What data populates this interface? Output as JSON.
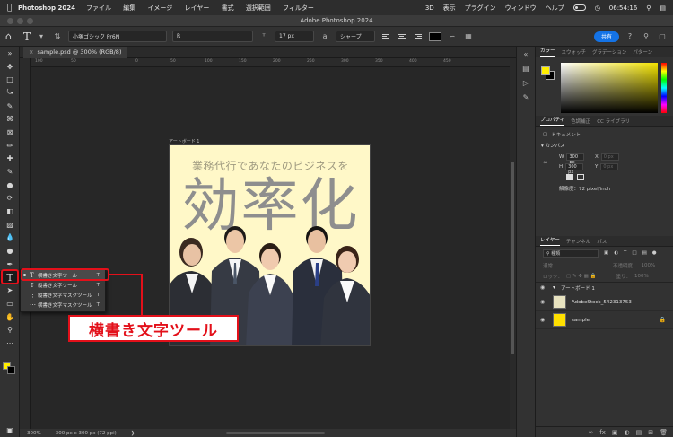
{
  "macbar": {
    "app": "Photoshop 2024",
    "menus": [
      "ファイル",
      "編集",
      "イメージ",
      "レイヤー",
      "書式",
      "選択範囲",
      "フィルター"
    ],
    "right_items": [
      "3D",
      "表示",
      "プラグイン",
      "ウィンドウ",
      "ヘルプ"
    ],
    "time": "06:54:16"
  },
  "titlebar": {
    "title": "Adobe Photoshop 2024"
  },
  "options": {
    "tool_glyph": "T",
    "font_family": "小塚ゴシック Pr6N",
    "font_style": "R",
    "font_size": "17 px",
    "antialias": "シャープ",
    "share_label": "共有"
  },
  "document": {
    "tab_title": "sample.psd @ 300% (RGB/8)",
    "ruler_ticks": [
      "100",
      "50",
      "0",
      "50",
      "100",
      "150",
      "200",
      "250",
      "300",
      "350",
      "400",
      "450"
    ],
    "artboard_label": "アートボード 1",
    "artboard_title": "業務代行であなたのビジネスを",
    "artboard_kanji": "効率化"
  },
  "status": {
    "zoom": "300%",
    "info": "300 px x 300 px (72 ppi)"
  },
  "flyout": {
    "items": [
      {
        "label": "横書き文字ツール",
        "shortcut": "T",
        "selected": true
      },
      {
        "label": "縦書き文字ツール",
        "shortcut": "T",
        "selected": false
      },
      {
        "label": "縦書き文字マスクツール",
        "shortcut": "T",
        "selected": false
      },
      {
        "label": "横書き文字マスクツール",
        "shortcut": "T",
        "selected": false
      }
    ]
  },
  "callout": {
    "text": "横書き文字ツール"
  },
  "color_panel": {
    "tabs": [
      "カラー",
      "スウォッチ",
      "グラデーション",
      "パターン"
    ],
    "foreground": "#ffee00",
    "background": "#000000"
  },
  "properties_panel": {
    "tabs": [
      "プロパティ",
      "色調補正",
      "CC ライブラリ"
    ],
    "doc_label": "ドキュメント",
    "canvas_label": "カンバス",
    "w_label": "W",
    "w_value": "300 px",
    "h_label": "H",
    "h_value": "300 px",
    "x_label": "X",
    "x_value": "0 px",
    "y_label": "Y",
    "y_value": "0 px",
    "resolution": "解像度：72 pixel/inch"
  },
  "layers_panel": {
    "tabs": [
      "レイヤー",
      "チャンネル",
      "パス"
    ],
    "filter_label": "種類",
    "blend_mode": "通常",
    "opacity_label": "不透明度：",
    "opacity_value": "100%",
    "lock_label": "ロック：",
    "fill_label": "塗り：",
    "fill_value": "100%",
    "layers": [
      {
        "name": "アートボード 1",
        "type": "group"
      },
      {
        "name": "AdobeStock_542313753",
        "type": "image"
      },
      {
        "name": "sample",
        "type": "image"
      }
    ]
  },
  "colors": {
    "accent_red": "#e3101a",
    "share_blue": "#1473e6"
  }
}
